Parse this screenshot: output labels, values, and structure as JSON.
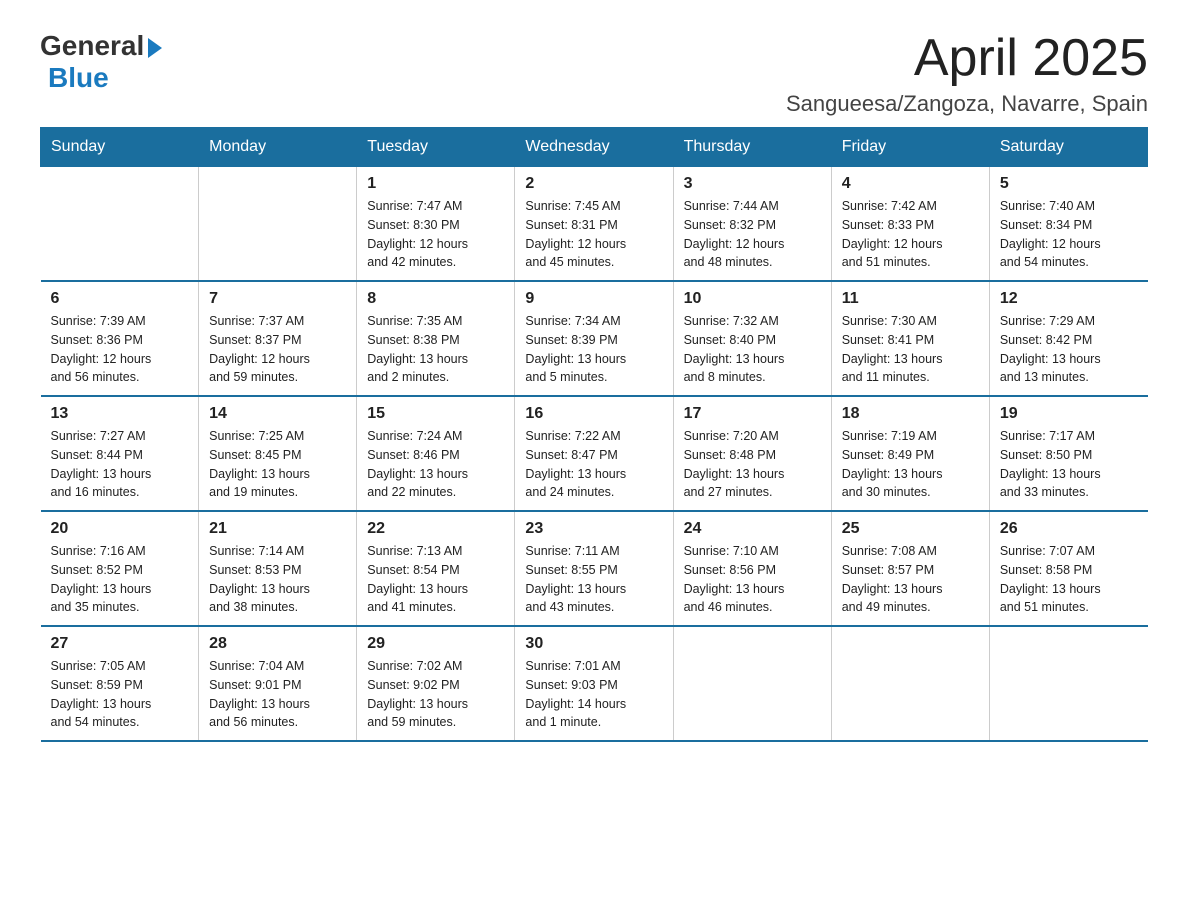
{
  "header": {
    "logo_general": "General",
    "logo_blue": "Blue",
    "month_title": "April 2025",
    "location": "Sangueesa/Zangoza, Navarre, Spain"
  },
  "weekdays": [
    "Sunday",
    "Monday",
    "Tuesday",
    "Wednesday",
    "Thursday",
    "Friday",
    "Saturday"
  ],
  "weeks": [
    [
      {
        "day": "",
        "info": ""
      },
      {
        "day": "",
        "info": ""
      },
      {
        "day": "1",
        "info": "Sunrise: 7:47 AM\nSunset: 8:30 PM\nDaylight: 12 hours\nand 42 minutes."
      },
      {
        "day": "2",
        "info": "Sunrise: 7:45 AM\nSunset: 8:31 PM\nDaylight: 12 hours\nand 45 minutes."
      },
      {
        "day": "3",
        "info": "Sunrise: 7:44 AM\nSunset: 8:32 PM\nDaylight: 12 hours\nand 48 minutes."
      },
      {
        "day": "4",
        "info": "Sunrise: 7:42 AM\nSunset: 8:33 PM\nDaylight: 12 hours\nand 51 minutes."
      },
      {
        "day": "5",
        "info": "Sunrise: 7:40 AM\nSunset: 8:34 PM\nDaylight: 12 hours\nand 54 minutes."
      }
    ],
    [
      {
        "day": "6",
        "info": "Sunrise: 7:39 AM\nSunset: 8:36 PM\nDaylight: 12 hours\nand 56 minutes."
      },
      {
        "day": "7",
        "info": "Sunrise: 7:37 AM\nSunset: 8:37 PM\nDaylight: 12 hours\nand 59 minutes."
      },
      {
        "day": "8",
        "info": "Sunrise: 7:35 AM\nSunset: 8:38 PM\nDaylight: 13 hours\nand 2 minutes."
      },
      {
        "day": "9",
        "info": "Sunrise: 7:34 AM\nSunset: 8:39 PM\nDaylight: 13 hours\nand 5 minutes."
      },
      {
        "day": "10",
        "info": "Sunrise: 7:32 AM\nSunset: 8:40 PM\nDaylight: 13 hours\nand 8 minutes."
      },
      {
        "day": "11",
        "info": "Sunrise: 7:30 AM\nSunset: 8:41 PM\nDaylight: 13 hours\nand 11 minutes."
      },
      {
        "day": "12",
        "info": "Sunrise: 7:29 AM\nSunset: 8:42 PM\nDaylight: 13 hours\nand 13 minutes."
      }
    ],
    [
      {
        "day": "13",
        "info": "Sunrise: 7:27 AM\nSunset: 8:44 PM\nDaylight: 13 hours\nand 16 minutes."
      },
      {
        "day": "14",
        "info": "Sunrise: 7:25 AM\nSunset: 8:45 PM\nDaylight: 13 hours\nand 19 minutes."
      },
      {
        "day": "15",
        "info": "Sunrise: 7:24 AM\nSunset: 8:46 PM\nDaylight: 13 hours\nand 22 minutes."
      },
      {
        "day": "16",
        "info": "Sunrise: 7:22 AM\nSunset: 8:47 PM\nDaylight: 13 hours\nand 24 minutes."
      },
      {
        "day": "17",
        "info": "Sunrise: 7:20 AM\nSunset: 8:48 PM\nDaylight: 13 hours\nand 27 minutes."
      },
      {
        "day": "18",
        "info": "Sunrise: 7:19 AM\nSunset: 8:49 PM\nDaylight: 13 hours\nand 30 minutes."
      },
      {
        "day": "19",
        "info": "Sunrise: 7:17 AM\nSunset: 8:50 PM\nDaylight: 13 hours\nand 33 minutes."
      }
    ],
    [
      {
        "day": "20",
        "info": "Sunrise: 7:16 AM\nSunset: 8:52 PM\nDaylight: 13 hours\nand 35 minutes."
      },
      {
        "day": "21",
        "info": "Sunrise: 7:14 AM\nSunset: 8:53 PM\nDaylight: 13 hours\nand 38 minutes."
      },
      {
        "day": "22",
        "info": "Sunrise: 7:13 AM\nSunset: 8:54 PM\nDaylight: 13 hours\nand 41 minutes."
      },
      {
        "day": "23",
        "info": "Sunrise: 7:11 AM\nSunset: 8:55 PM\nDaylight: 13 hours\nand 43 minutes."
      },
      {
        "day": "24",
        "info": "Sunrise: 7:10 AM\nSunset: 8:56 PM\nDaylight: 13 hours\nand 46 minutes."
      },
      {
        "day": "25",
        "info": "Sunrise: 7:08 AM\nSunset: 8:57 PM\nDaylight: 13 hours\nand 49 minutes."
      },
      {
        "day": "26",
        "info": "Sunrise: 7:07 AM\nSunset: 8:58 PM\nDaylight: 13 hours\nand 51 minutes."
      }
    ],
    [
      {
        "day": "27",
        "info": "Sunrise: 7:05 AM\nSunset: 8:59 PM\nDaylight: 13 hours\nand 54 minutes."
      },
      {
        "day": "28",
        "info": "Sunrise: 7:04 AM\nSunset: 9:01 PM\nDaylight: 13 hours\nand 56 minutes."
      },
      {
        "day": "29",
        "info": "Sunrise: 7:02 AM\nSunset: 9:02 PM\nDaylight: 13 hours\nand 59 minutes."
      },
      {
        "day": "30",
        "info": "Sunrise: 7:01 AM\nSunset: 9:03 PM\nDaylight: 14 hours\nand 1 minute."
      },
      {
        "day": "",
        "info": ""
      },
      {
        "day": "",
        "info": ""
      },
      {
        "day": "",
        "info": ""
      }
    ]
  ]
}
